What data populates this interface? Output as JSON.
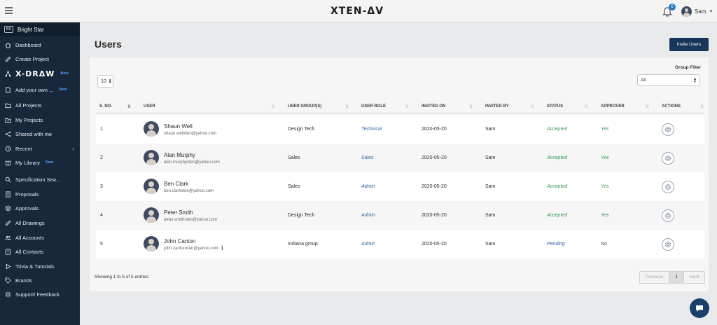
{
  "header": {
    "logo": "XTEN-ΔV",
    "notification_count": "0",
    "user_name": "Sam"
  },
  "sidebar": {
    "brand_badge": "BS",
    "brand_name": "Bright Star",
    "items": [
      {
        "label": "Dashboard",
        "icon": "home-icon"
      },
      {
        "label": "Create Project",
        "icon": "pencil-icon"
      },
      {
        "label": "X-DRΔW",
        "icon": "network-icon",
        "tag": "New"
      },
      {
        "label": "Add your own ...",
        "icon": "document-icon",
        "tag": "New"
      },
      {
        "label": "All Projects",
        "icon": "folder-icon"
      },
      {
        "label": "My Projects",
        "icon": "folder-user-icon"
      },
      {
        "label": "Shared with me",
        "icon": "share-icon"
      },
      {
        "label": "Recent",
        "icon": "clock-icon"
      },
      {
        "label": "My Library",
        "icon": "book-icon",
        "tag": "New"
      },
      {
        "label": "Specification Sea...",
        "icon": "search-icon"
      },
      {
        "label": "Proposals",
        "icon": "proposal-icon"
      },
      {
        "label": "Approvals",
        "icon": "approval-icon"
      },
      {
        "label": "All Drawings",
        "icon": "drawing-icon"
      },
      {
        "label": "All Accounts",
        "icon": "accounts-icon"
      },
      {
        "label": "All Contacts",
        "icon": "contacts-icon"
      },
      {
        "label": "Trivia & Tutorials",
        "icon": "play-icon"
      },
      {
        "label": "Brands",
        "icon": "tag-icon"
      },
      {
        "label": "Support/ Feedback",
        "icon": "gear-icon"
      }
    ]
  },
  "page": {
    "title": "Users",
    "invite_label": "Invite Users",
    "page_size": "10",
    "group_filter_label": "Group Filter",
    "group_filter_value": "All"
  },
  "table": {
    "headers": [
      "S. NO.",
      "USER",
      "USER GROUP(S)",
      "USER ROLE",
      "INVITED ON",
      "INVITED BY",
      "STATUS",
      "APPROVER",
      "ACTIONS"
    ],
    "rows": [
      {
        "sno": "1",
        "name": "Shaun Well",
        "email": "shaun.wellxten@yahoo.com",
        "group": "Design Tech",
        "role": "Technical",
        "invited_on": "2020-05-20",
        "invited_by": "Sam",
        "status": "Accepted",
        "approver": "Yes"
      },
      {
        "sno": "2",
        "name": "Alan Murphy",
        "email": "alan.murphyxten@yahoo.com",
        "group": "Sales",
        "role": "Sales",
        "invited_on": "2020-05-20",
        "invited_by": "Sam",
        "status": "Accepted",
        "approver": "Yes"
      },
      {
        "sno": "3",
        "name": "Ben Clark",
        "email": "ben.clarkxten@yahoo.com",
        "group": "Sales",
        "role": "Admin",
        "invited_on": "2020-05-20",
        "invited_by": "Sam",
        "status": "Accepted",
        "approver": "Yes"
      },
      {
        "sno": "4",
        "name": "Peter Smith",
        "email": "peter.smithxten@yahoo.com",
        "group": "Design Tech",
        "role": "Admin",
        "invited_on": "2020-05-20",
        "invited_by": "Sam",
        "status": "Accepted",
        "approver": "Yes"
      },
      {
        "sno": "5",
        "name": "John Canton",
        "email": "john.cantonxten@yahoo.com",
        "group": "Indiana group",
        "role": "Admin",
        "invited_on": "2020-05-20",
        "invited_by": "Sam",
        "status": "Pending",
        "approver": "No"
      }
    ]
  },
  "footer": {
    "info": "Showing 1 to 5 of 5 entries",
    "previous": "Previous",
    "current_page": "1",
    "next": "Next"
  },
  "colors": {
    "sidebar_bg": "#17283b",
    "primary_button": "#18355a",
    "accepted": "#2e9b52",
    "role_link": "#2f5fa8",
    "new_tag": "#4aa3ff"
  }
}
